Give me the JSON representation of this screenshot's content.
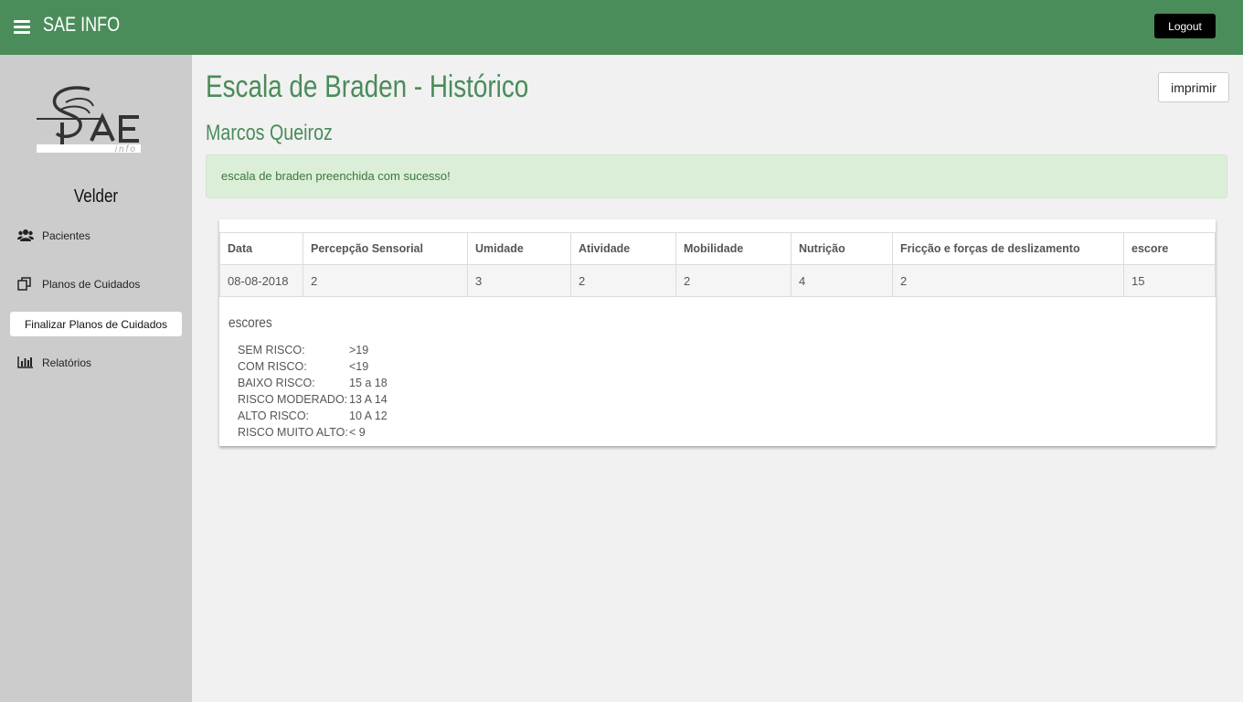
{
  "header": {
    "brand": "SAE INFO",
    "logout_label": "Logout"
  },
  "sidebar": {
    "logo_text": "SAE info",
    "user_name": "Velder",
    "items": [
      {
        "label": "Pacientes",
        "icon": "users-icon"
      },
      {
        "label": "Planos de Cuidados",
        "icon": "copy-icon"
      },
      {
        "label": "Finalizar Planos de Cuidados",
        "active": true
      },
      {
        "label": "Relatórios",
        "icon": "bar-chart-icon"
      }
    ]
  },
  "main": {
    "title": "Escala de Braden - Histórico",
    "patient": "Marcos Queiroz",
    "print_label": "imprimir",
    "alert": "escala de braden preenchida com sucesso!",
    "table": {
      "headers": [
        "Data",
        "Percepção Sensorial",
        "Umidade",
        "Atividade",
        "Mobilidade",
        "Nutrição",
        "Fricção e forças de deslizamento",
        "escore"
      ],
      "rows": [
        [
          "08-08-2018",
          "2",
          "3",
          "2",
          "2",
          "4",
          "2",
          "15"
        ]
      ]
    },
    "escores": {
      "title": "escores",
      "items": [
        {
          "label": "SEM RISCO:",
          "value": ">19"
        },
        {
          "label": "COM RISCO:",
          "value": "<19"
        },
        {
          "label": "BAIXO RISCO:",
          "value": "15 a 18"
        },
        {
          "label": "RISCO MODERADO:",
          "value": "13 A 14"
        },
        {
          "label": "ALTO RISCO:",
          "value": "10 A 12"
        },
        {
          "label": "RISCO MUITO ALTO:",
          "value": "< 9"
        }
      ]
    }
  },
  "colors": {
    "primary_green": "#4a8c5a",
    "sidebar_bg": "#cccccc",
    "alert_bg": "#dbefd8"
  }
}
